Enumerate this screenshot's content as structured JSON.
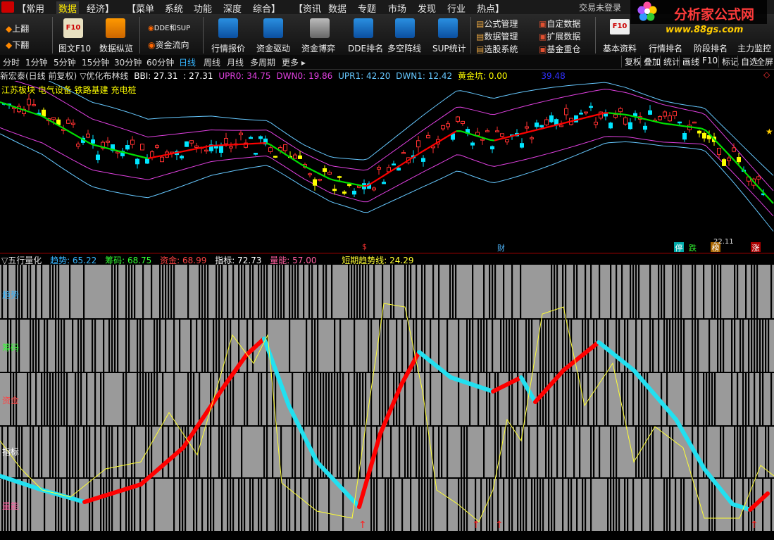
{
  "menu": {
    "items": [
      "【常用",
      "数据",
      "经济】",
      "【菜单",
      "系统",
      "功能",
      "深度",
      "综合】",
      "【资讯",
      "数据",
      "专题",
      "市场",
      "发现",
      "行业",
      "热点】"
    ],
    "active_index": 1,
    "account": "交易未登录"
  },
  "brand": {
    "name": "分析家公式网",
    "url": "www.88gs.com"
  },
  "toolbar": {
    "page_up": "上翻",
    "page_down": "下翻",
    "f10_icon_text": "F10",
    "graphic_f10": "图文F10",
    "data_overview": "数据纵览",
    "dde_sup": "DDE和SUP",
    "capital_flow": "资金流向",
    "quote": "行情报价",
    "capital_drive": "资金驱动",
    "capital_game": "资金博弈",
    "dde_rank": "DDE排名",
    "bull_bear": "多空阵线",
    "sup_stats": "SUP统计",
    "formula_mgmt": "公式管理",
    "data_mgmt": "数据管理",
    "stock_select": "选股系统",
    "custom_data": "自定数据",
    "ext_data": "扩展数据",
    "fund_holdings": "基金重仓",
    "basic_info": "基本资料",
    "quote_rank": "行情排名",
    "stage_rank": "阶段排名",
    "main_monitor": "主力监控"
  },
  "periods": [
    "分时",
    "1分钟",
    "5分钟",
    "15分钟",
    "30分钟",
    "60分钟",
    "日线",
    "周线",
    "月线",
    "多周期",
    "更多 ▸"
  ],
  "active_period": "日线",
  "right_tools": [
    "复权",
    "叠加",
    "统计",
    "画线",
    "F10",
    "标记",
    "自选",
    "全屏"
  ],
  "main_info": {
    "stock": "新宏泰(日线 前复权)",
    "indicator": "▽优化布林线",
    "bbi": "BBI: 27.31",
    "bbi2": ": 27.31",
    "upr0": "UPR0: 34.75",
    "dwn0": "DWN0: 19.86",
    "upr1": "UPR1: 42.20",
    "dwn1": "DWN1: 12.42",
    "gold": "黄金坑: 0.00",
    "extra": "39.48"
  },
  "sector_tags": "江苏板块 电气设备 铁路基建 充电桩",
  "markers": {
    "cai": "财",
    "ting": "停",
    "die": "跌",
    "bang": "榜",
    "zhang": "涨",
    "low_price": "22.11"
  },
  "lower_info": {
    "title": "▽五行量化",
    "trend": "趋势: 65.22",
    "chip": "筹码: 68.75",
    "fund": "资金: 68.99",
    "index": "指标: 72.73",
    "volume": "量能: 57.00",
    "short": "短期趋势线: 24.29"
  },
  "row_labels": [
    "趋势",
    "筹码",
    "资金",
    "指标",
    "量能"
  ],
  "colors": {
    "up": "#ff3030",
    "down": "#00e5ff",
    "bbi_rise": "#ff0000",
    "bbi_fall": "#00e000",
    "band_outer": "#66c8ff",
    "band_inner": "#e040e0",
    "thick_up": "#ff0000",
    "thick_down": "#22e0f0",
    "thin_line": "#ffff33",
    "panel_bg": "#9a9a9a"
  },
  "chart_data": {
    "type": "line",
    "title": "五行量化",
    "series": [
      {
        "name": "短期趋势线",
        "last": 24.29
      },
      {
        "name": "趋势",
        "last": 65.22
      },
      {
        "name": "筹码",
        "last": 68.75
      },
      {
        "name": "资金",
        "last": 68.99
      },
      {
        "name": "指标",
        "last": 72.73
      },
      {
        "name": "量能",
        "last": 57.0
      }
    ]
  }
}
